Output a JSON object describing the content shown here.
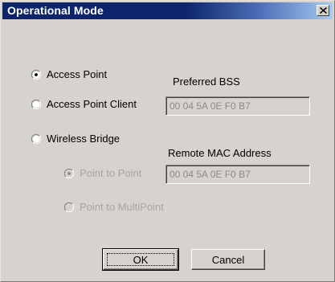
{
  "window": {
    "title": "Operational Mode",
    "close_label": "close"
  },
  "modes": {
    "access_point": "Access Point",
    "access_point_client": "Access Point Client",
    "wireless_bridge": "Wireless Bridge",
    "selected": "Access Point"
  },
  "bridge_modes": {
    "point_to_point": "Point to Point",
    "point_to_multipoint": "Point to MultiPoint",
    "selected": "Point to Point",
    "enabled": false
  },
  "preferred_bss": {
    "label": "Preferred BSS",
    "value": "00 04 5A 0E F0 B7",
    "enabled": false
  },
  "remote_mac": {
    "label": "Remote MAC Address",
    "value": "00 04 5A 0E F0 B7",
    "enabled": false
  },
  "buttons": {
    "ok": "OK",
    "cancel": "Cancel"
  },
  "colors": {
    "title_bar_start": "#0b246a",
    "title_bar_end": "#a6caf0",
    "dialog_face": "#d6d3ce",
    "disabled_text": "#8c8a86"
  }
}
